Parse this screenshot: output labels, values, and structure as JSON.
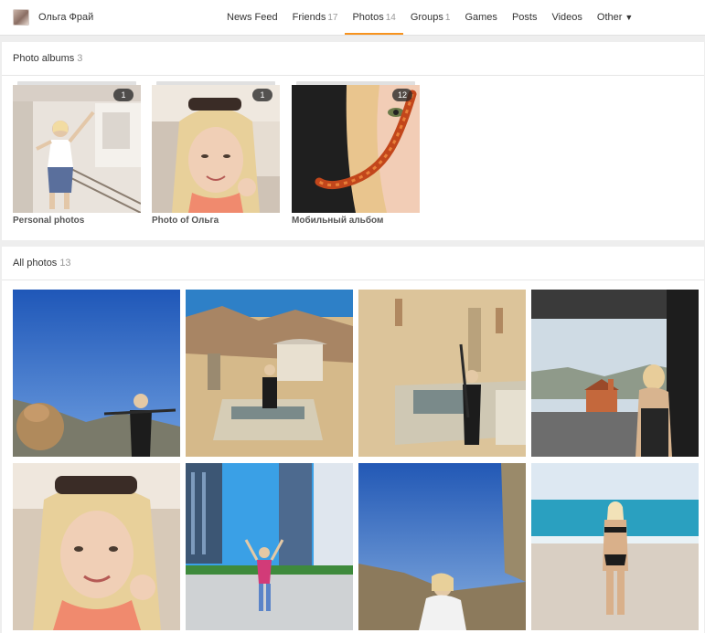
{
  "profile": {
    "name": "Ольга Фрай"
  },
  "nav": {
    "items": [
      {
        "label": "News Feed",
        "count": ""
      },
      {
        "label": "Friends",
        "count": "17"
      },
      {
        "label": "Photos",
        "count": "14",
        "active": true
      },
      {
        "label": "Groups",
        "count": "1"
      },
      {
        "label": "Games",
        "count": ""
      },
      {
        "label": "Posts",
        "count": ""
      },
      {
        "label": "Videos",
        "count": ""
      },
      {
        "label": "Other",
        "count": ""
      }
    ],
    "other_caret": "▼"
  },
  "albums_section": {
    "title": "Photo albums",
    "count": "3",
    "albums": [
      {
        "title": "Personal photos",
        "badge": "1"
      },
      {
        "title": "Photo of Ольга",
        "badge": "1"
      },
      {
        "title": "Мобильный альбом",
        "badge": "12"
      }
    ]
  },
  "photos_section": {
    "title": "All photos",
    "count": "13"
  },
  "colors": {
    "accent": "#f7931e",
    "count_gray": "#999999"
  }
}
